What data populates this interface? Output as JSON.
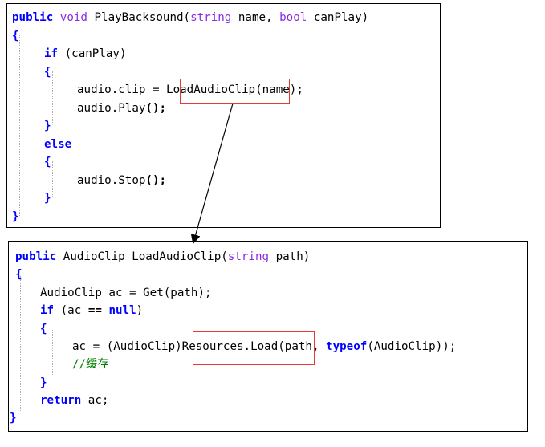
{
  "panel1": {
    "sig": {
      "kw1": "public",
      "kw2": "void",
      "name": " PlayBacksound(",
      "t1": "string",
      "p1": " name, ",
      "t2": "bool",
      "p2": " canPlay)"
    },
    "open_brace": "{",
    "if_kw": "if",
    "if_cond": " (canPlay)",
    "if_open": "{",
    "assign_pre": "audio.clip = ",
    "assign_hl": "LoadAudioClip",
    "assign_post": "(name);",
    "play_pre": "audio.Play",
    "play_post": "();",
    "if_close": "}",
    "else_kw": "else",
    "else_open": "{",
    "stop_pre": "audio.Stop",
    "stop_post": "();",
    "else_close": "}",
    "close_brace": "}"
  },
  "panel2": {
    "sig": {
      "kw1": "public",
      "name": " AudioClip LoadAudioClip(",
      "t1": "string",
      "p1": " path)"
    },
    "open_brace": "{",
    "get_line": "AudioClip ac = Get(path);",
    "if_kw": "if",
    "if_mid": " (ac ",
    "if_op": "==",
    "if_null": "null",
    "if_end": ")",
    "if_open": "{",
    "assign_pre": "ac = (AudioClip)",
    "assign_hl": "Resources.Load",
    "assign_mid": "(path, ",
    "typeof_kw": "typeof",
    "assign_post": "(AudioClip));",
    "comment": "//缓存",
    "if_close": "}",
    "return_kw": "return",
    "return_rest": " ac;",
    "close_brace": "}"
  },
  "colors": {
    "keyword": "#0000ff",
    "type": "#8a2be2",
    "comment": "#008000",
    "highlight_border": "#e53935",
    "panel_border": "#000000"
  }
}
